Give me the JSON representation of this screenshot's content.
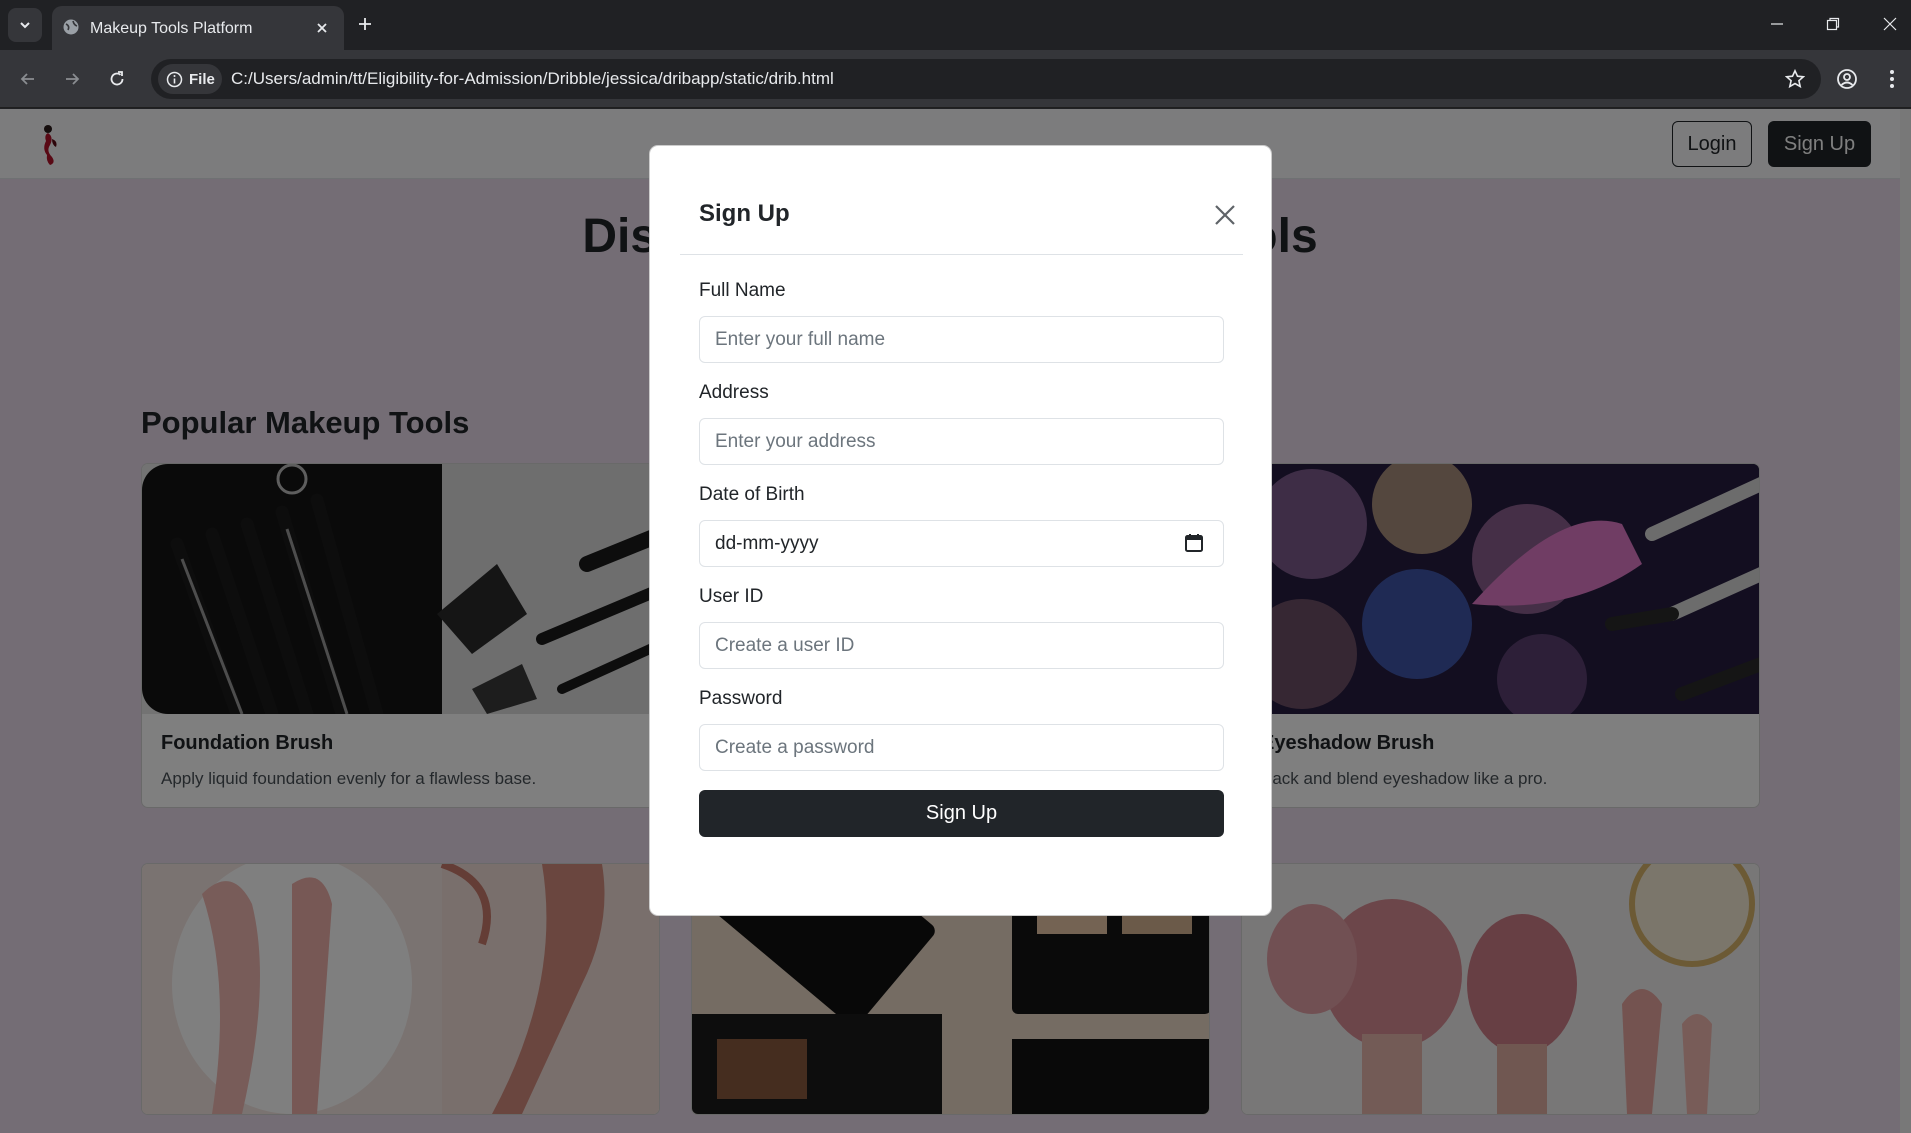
{
  "browser": {
    "tab_title": "Makeup Tools Platform",
    "chip_label": "File",
    "url": "C:/Users/admin/tt/Eligibility-for-Admission/Dribble/jessica/dribapp/static/drib.html",
    "icons": [
      "tab-search-icon",
      "globe-icon",
      "close-icon",
      "plus-icon",
      "minimize-icon",
      "restore-icon",
      "back-icon",
      "forward-icon",
      "reload-icon",
      "info-icon",
      "star-icon",
      "profile-icon",
      "menu-icon"
    ]
  },
  "site": {
    "nav": {
      "login_label": "Login",
      "signup_label": "Sign Up"
    },
    "hero_title": "Discover the Best Makeup Tools",
    "section_title": "Popular Makeup Tools",
    "cards": [
      {
        "title": "Foundation Brush",
        "text": "Apply liquid foundation evenly for a flawless base."
      },
      {
        "title": "Eyeshadow Brush",
        "text": "Pack and blend eyeshadow like a pro."
      }
    ]
  },
  "modal": {
    "title": "Sign Up",
    "fields": [
      {
        "label": "Full Name",
        "placeholder": "Enter your full name"
      },
      {
        "label": "Address",
        "placeholder": "Enter your address"
      },
      {
        "label": "Date of Birth",
        "value": "dd-mm-yyyy"
      },
      {
        "label": "User ID",
        "placeholder": "Create a user ID"
      },
      {
        "label": "Password",
        "placeholder": "Create a password"
      }
    ],
    "submit_label": "Sign Up"
  },
  "colors": {
    "page_bg": "#e9dbeb",
    "dark_button": "#212529",
    "chrome_bg": "#202124"
  }
}
